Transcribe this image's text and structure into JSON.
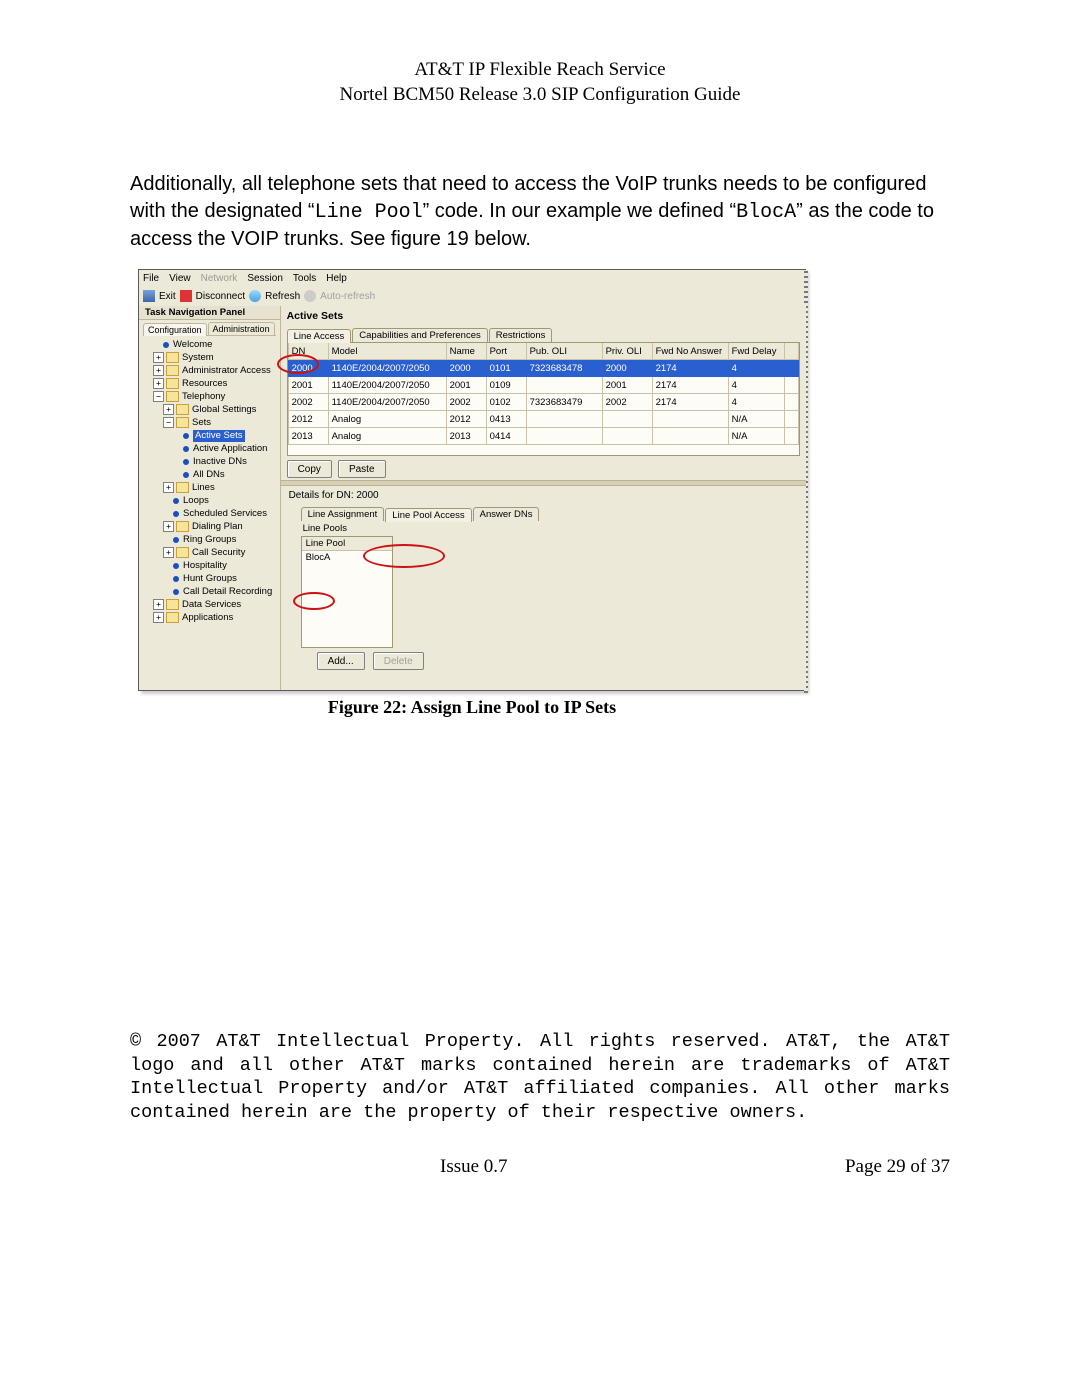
{
  "doc": {
    "header1": "AT&T IP Flexible Reach Service",
    "header2": "Nortel BCM50 Release 3.0 SIP Configuration Guide",
    "para": "Additionally, all telephone sets that need to access the VoIP trunks needs to be configured with the designated “",
    "para_code1": "Line Pool",
    "para_mid": "” code.  In our example we defined “",
    "para_code2": "BlocA",
    "para_end": "” as the code to access the VOIP trunks.  See figure 19 below.",
    "caption": "Figure 22: Assign Line Pool to IP Sets",
    "copyright": "© 2007 AT&T Intellectual Property. All rights reserved. AT&T, the AT&T logo and all other AT&T marks contained herein are trademarks of AT&T Intellectual Property and/or AT&T affiliated companies.  All other marks contained herein are the property of their respective owners.",
    "issue": "Issue 0.7",
    "pageno": "Page 29 of 37"
  },
  "menubar": {
    "file": "File",
    "view": "View",
    "network": "Network",
    "session": "Session",
    "tools": "Tools",
    "help": "Help"
  },
  "toolbar": {
    "exit": "Exit",
    "disconnect": "Disconnect",
    "refresh": "Refresh",
    "auto": "Auto-refresh"
  },
  "leftPanel": {
    "title": "Task Navigation Panel",
    "tabs": {
      "config": "Configuration",
      "admin": "Administration"
    }
  },
  "tree": {
    "welcome": "Welcome",
    "system": "System",
    "adminAccess": "Administrator Access",
    "resources": "Resources",
    "telephony": "Telephony",
    "globalSettings": "Global Settings",
    "sets": "Sets",
    "activeSets": "Active Sets",
    "activeApp": "Active Application",
    "inactiveDNs": "Inactive DNs",
    "allDNs": "All DNs",
    "lines": "Lines",
    "loops": "Loops",
    "scheduled": "Scheduled Services",
    "dialingPlan": "Dialing Plan",
    "ringGroups": "Ring Groups",
    "callSecurity": "Call Security",
    "hospitality": "Hospitality",
    "huntGroups": "Hunt Groups",
    "cdr": "Call Detail Recording",
    "dataServices": "Data Services",
    "applications": "Applications"
  },
  "rightPanel": {
    "title": "Active Sets",
    "tabs": {
      "lineAccess": "Line Access",
      "caps": "Capabilities and Preferences",
      "restrictions": "Restrictions"
    }
  },
  "table": {
    "headers": {
      "dn": "DN",
      "model": "Model",
      "name": "Name",
      "port": "Port",
      "puboli": "Pub. OLI",
      "privoli": "Priv. OLI",
      "fwdna": "Fwd No Answer",
      "fwddelay": "Fwd Delay"
    },
    "rows": [
      {
        "dn": "2000",
        "model": "1140E/2004/2007/2050",
        "name": "2000",
        "port": "0101",
        "puboli": "7323683478",
        "privoli": "2000",
        "fwdna": "2174",
        "fwddelay": "4",
        "sel": true
      },
      {
        "dn": "2001",
        "model": "1140E/2004/2007/2050",
        "name": "2001",
        "port": "0109",
        "puboli": "",
        "privoli": "2001",
        "fwdna": "2174",
        "fwddelay": "4"
      },
      {
        "dn": "2002",
        "model": "1140E/2004/2007/2050",
        "name": "2002",
        "port": "0102",
        "puboli": "7323683479",
        "privoli": "2002",
        "fwdna": "2174",
        "fwddelay": "4"
      },
      {
        "dn": "2012",
        "model": "Analog",
        "name": "2012",
        "port": "0413",
        "puboli": "",
        "privoli": "",
        "fwdna": "",
        "fwddelay": "N/A"
      },
      {
        "dn": "2013",
        "model": "Analog",
        "name": "2013",
        "port": "0414",
        "puboli": "",
        "privoli": "",
        "fwdna": "",
        "fwddelay": "N/A"
      }
    ]
  },
  "buttons": {
    "copy": "Copy",
    "paste": "Paste",
    "add": "Add...",
    "delete": "Delete"
  },
  "details": {
    "title": "Details for DN: 2000",
    "tabs": {
      "lineAssign": "Line Assignment",
      "linePoolAccess": "Line Pool Access",
      "answerDNs": "Answer DNs"
    },
    "linePoolsLabel": "Line Pools",
    "linePoolHdr": "Line Pool",
    "linePoolVal": "BlocA"
  }
}
